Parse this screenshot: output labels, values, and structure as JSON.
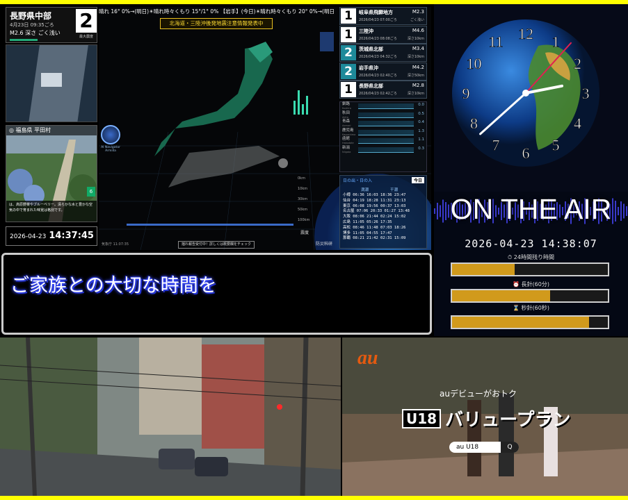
{
  "quake": {
    "region": "長野県中部",
    "time": "4月23日 09:35ごろ",
    "magnitude": "M2.6",
    "depth": "深さ ごく浅い",
    "max_shindo": "2",
    "max_label": "最大震度"
  },
  "photo": {
    "header": "福島県 平田村",
    "caption": "は、高原野菜やブルーベリー。清らかな水と豊かな空気の中で育まれた味覚は格別です。",
    "badge": "6"
  },
  "clock_box": {
    "date": "2026-04-23",
    "time": "14:37:45"
  },
  "map": {
    "ticker": "晴れ 16° 0%→(明日)☀晴れ時々くもり 15°/1° 0% 【岩手】(今日)☀晴れ時々くもり 20° 0%→(明日)☀晴れ時々",
    "alert": "北海道・三陸沖後発地震注意情報発表中",
    "navigator": "AI Navigator Armilla",
    "button": "揺れ報告受付中！詳しくは概要欄をチェック",
    "stamp": "気象庁 11:07:35",
    "depth_labels": [
      "0km",
      "10km",
      "30km",
      "50km",
      "100km"
    ],
    "tag1": "震度",
    "tag2": "防災科研"
  },
  "eq_list": [
    {
      "shindo": "1",
      "blue": false,
      "name": "岐阜県飛騨地方",
      "mag": "M2.3",
      "date": "2026/04/23 07:00ごろ",
      "depth": "ごく浅い"
    },
    {
      "shindo": "1",
      "blue": false,
      "name": "三陸沖",
      "mag": "M4.6",
      "date": "2026/04/23 08:08ごろ",
      "depth": "深さ10km"
    },
    {
      "shindo": "2",
      "blue": true,
      "name": "茨城県北部",
      "mag": "M3.4",
      "date": "2026/04/23 04:32ごろ",
      "depth": "深さ10km"
    },
    {
      "shindo": "2",
      "blue": true,
      "name": "岩手県沖",
      "mag": "M4.2",
      "date": "2026/04/23 02:40ごろ",
      "depth": "深さ50km"
    },
    {
      "shindo": "1",
      "blue": false,
      "name": "長野県北部",
      "mag": "M2.8",
      "date": "2026/04/23 02:42ごろ",
      "depth": "深さ10km"
    }
  ],
  "stations": [
    {
      "name": "釧路",
      "roman": "Kushiro",
      "value": "0.0"
    },
    {
      "name": "秋田",
      "roman": "Akita",
      "value": "0.5"
    },
    {
      "name": "青森",
      "roman": "Aomori",
      "value": "0.4"
    },
    {
      "name": "鹿児島",
      "roman": "Kagoshima",
      "value": "1.3"
    },
    {
      "name": "函館",
      "roman": "Hakodate",
      "value": "1.1"
    },
    {
      "name": "新潟",
      "roman": "Niigata",
      "value": "0.3"
    }
  ],
  "sun": {
    "title": "日の出・日の入",
    "today": "今日",
    "col1": "満潮",
    "col2": "干潮",
    "rows": [
      "小樽 06:36 16:03 18:36 23:47",
      "仙台 04:19 18:28 11:31 23:13",
      "東京 06:08 19:56 00:37 13:03",
      "名古屋 07:06 20:33 01:27 13:48",
      "大阪 08:06 21:44 02:24 15:02",
      "広島 11:05 05:26 17:35",
      "高松 08:46 11:48 07:03 18:26",
      "博多 11:05 04:55 17:47",
      "那覇 08:21 21:42 02:31 15:09"
    ]
  },
  "subtitle": "ご家族との大切な時間を",
  "right_panel": {
    "onair": "ON THE AIR",
    "datetime": "2026-04-23 14:38:07",
    "bars": [
      {
        "label": "24時間残り時間",
        "fill": 0.4
      },
      {
        "label": "長針(60分)",
        "fill": 0.63
      },
      {
        "label": "秒針(60秒)",
        "fill": 0.88
      }
    ],
    "clock_numerals": [
      "12",
      "1",
      "2",
      "3",
      "4",
      "5",
      "6",
      "7",
      "8",
      "9",
      "10",
      "11"
    ],
    "hour_hand": 14.63,
    "minute_hand": 38,
    "second_hand": 7
  },
  "ad": {
    "logo": "au",
    "debut": "auデビューがおトク",
    "badge": "U18",
    "plan": "バリュープラン",
    "search": "au U18",
    "search_btn": "Q"
  }
}
